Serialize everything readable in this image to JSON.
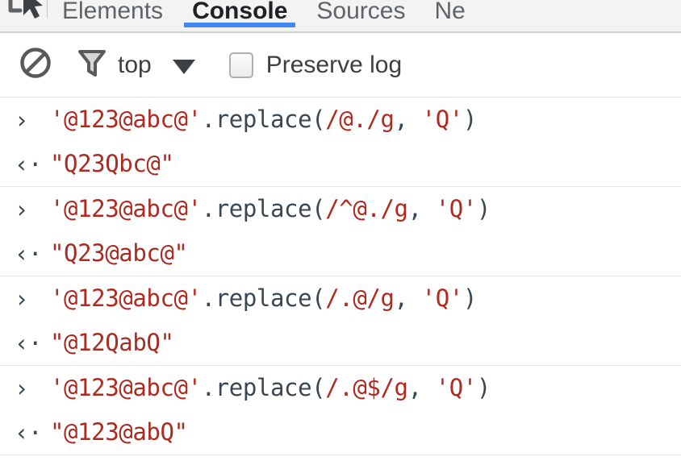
{
  "tabstrip": {
    "inspect_icon": "inspect-element-cursor-icon",
    "tabs": [
      {
        "label": "Elements",
        "active": false
      },
      {
        "label": "Console",
        "active": true
      },
      {
        "label": "Sources",
        "active": false
      },
      {
        "label": "Ne",
        "active": false
      }
    ],
    "active_underline_color": "#4285f4"
  },
  "toolbar": {
    "clear_icon": "clear-console-icon",
    "filter_icon": "filter-funnel-icon",
    "context_label": "top",
    "context_caret_icon": "chevron-down-icon",
    "preserve_log_label": "Preserve log",
    "preserve_log_checked": false
  },
  "console": {
    "input_marker": "›",
    "output_marker": "‹·",
    "groups": [
      {
        "input": {
          "string_literal": "'@123@abc@'",
          "method": ".replace(",
          "regex": "/@./g",
          "comma": ", ",
          "replacement": "'Q'",
          "close": ")"
        },
        "output": "\"Q23Qbc@\""
      },
      {
        "input": {
          "string_literal": "'@123@abc@'",
          "method": ".replace(",
          "regex": "/^@./g",
          "comma": ", ",
          "replacement": "'Q'",
          "close": ")"
        },
        "output": "\"Q23@abc@\""
      },
      {
        "input": {
          "string_literal": "'@123@abc@'",
          "method": ".replace(",
          "regex": "/.@/g",
          "comma": ", ",
          "replacement": "'Q'",
          "close": ")"
        },
        "output": "\"@12QabQ\""
      },
      {
        "input": {
          "string_literal": "'@123@abc@'",
          "method": ".replace(",
          "regex": "/.@$/g",
          "comma": ", ",
          "replacement": "'Q'",
          "close": ")"
        },
        "output": "\"@123@abQ\""
      }
    ]
  }
}
